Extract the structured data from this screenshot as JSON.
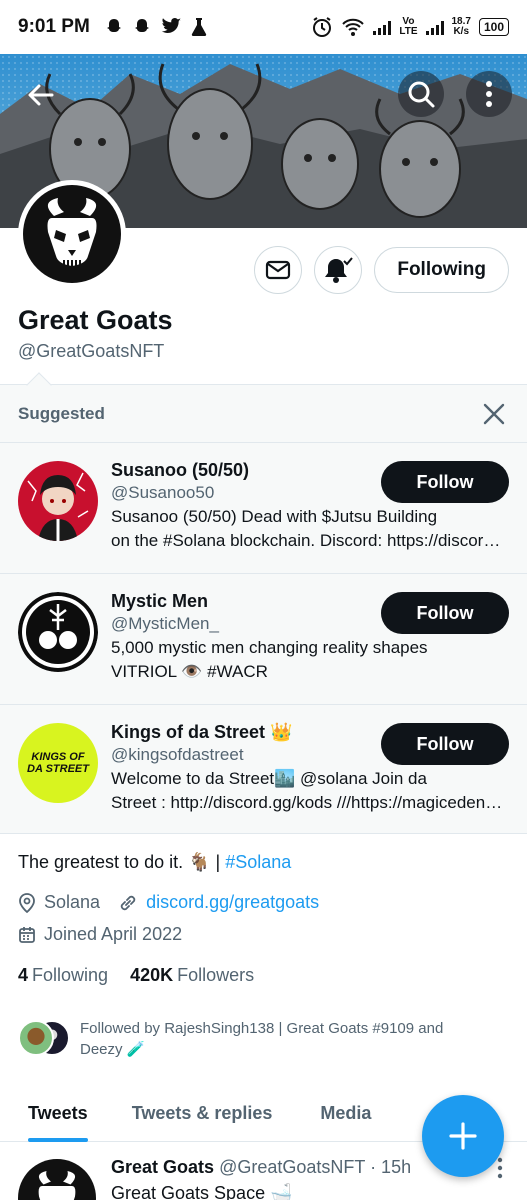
{
  "status_bar": {
    "time": "9:01 PM",
    "network_speed_value": "18.7",
    "network_speed_unit": "K/s",
    "network_label_top": "Vo",
    "network_label_bottom": "LTE",
    "battery": "100",
    "icons": [
      "snapchat-icon",
      "snapchat-icon",
      "twitter-icon",
      "flask-icon",
      "alarm-icon",
      "wifi-icon",
      "signal-icon",
      "signal-icon"
    ]
  },
  "header": {
    "back_icon": "arrow-left-icon",
    "search_icon": "search-icon",
    "more_icon": "more-vertical-icon"
  },
  "profile": {
    "name": "Great Goats",
    "handle": "@GreatGoatsNFT",
    "following_button": "Following",
    "bio_text": "The greatest to do it. 🐐 | ",
    "bio_hashtag": "#Solana",
    "location": "Solana",
    "website": "discord.gg/greatgoats",
    "joined": "Joined April 2022",
    "following_count": "4",
    "following_label": "Following",
    "followers_count": "420K",
    "followers_label": "Followers",
    "followed_by_line1": "Followed by RajeshSingh138 | Great Goats #9109 and",
    "followed_by_line2": "Deezy 🧪"
  },
  "suggested": {
    "title": "Suggested",
    "items": [
      {
        "name": "Susanoo (50/50)",
        "handle": "@Susanoo50",
        "bio_line1": "Susanoo (50/50) Dead with $Jutsu Building",
        "bio_line2": "on the #Solana blockchain.   Discord: https://discord.gg/susanoo",
        "button": "Follow"
      },
      {
        "name": "Mystic Men",
        "handle": "@MysticMen_",
        "bio_line1": "5,000 mystic men changing reality shapes",
        "bio_line2": "VITRIOL 👁️  #WACR",
        "button": "Follow"
      },
      {
        "name": "Kings of da Street 👑",
        "handle": "@kingsofdastreet",
        "bio_line1": "Welcome to da Street🏙️ @solana Join da",
        "bio_line2": "Street : http://discord.gg/kods ///https://magiceden.io",
        "avatar_text": "KINGS OF DA STREET",
        "button": "Follow"
      }
    ]
  },
  "tabs": [
    {
      "label": "Tweets",
      "active": true
    },
    {
      "label": "Tweets & replies",
      "active": false
    },
    {
      "label": "Media",
      "active": false
    }
  ],
  "tweet": {
    "author": "Great Goats",
    "handle": "@GreatGoatsNFT",
    "time": "· 15h",
    "text": "Great Goats Space 🛁"
  },
  "colors": {
    "accent": "#1d9bf0",
    "text_primary": "#0f1419",
    "text_secondary": "#536471",
    "button_dark": "#0f1419"
  }
}
